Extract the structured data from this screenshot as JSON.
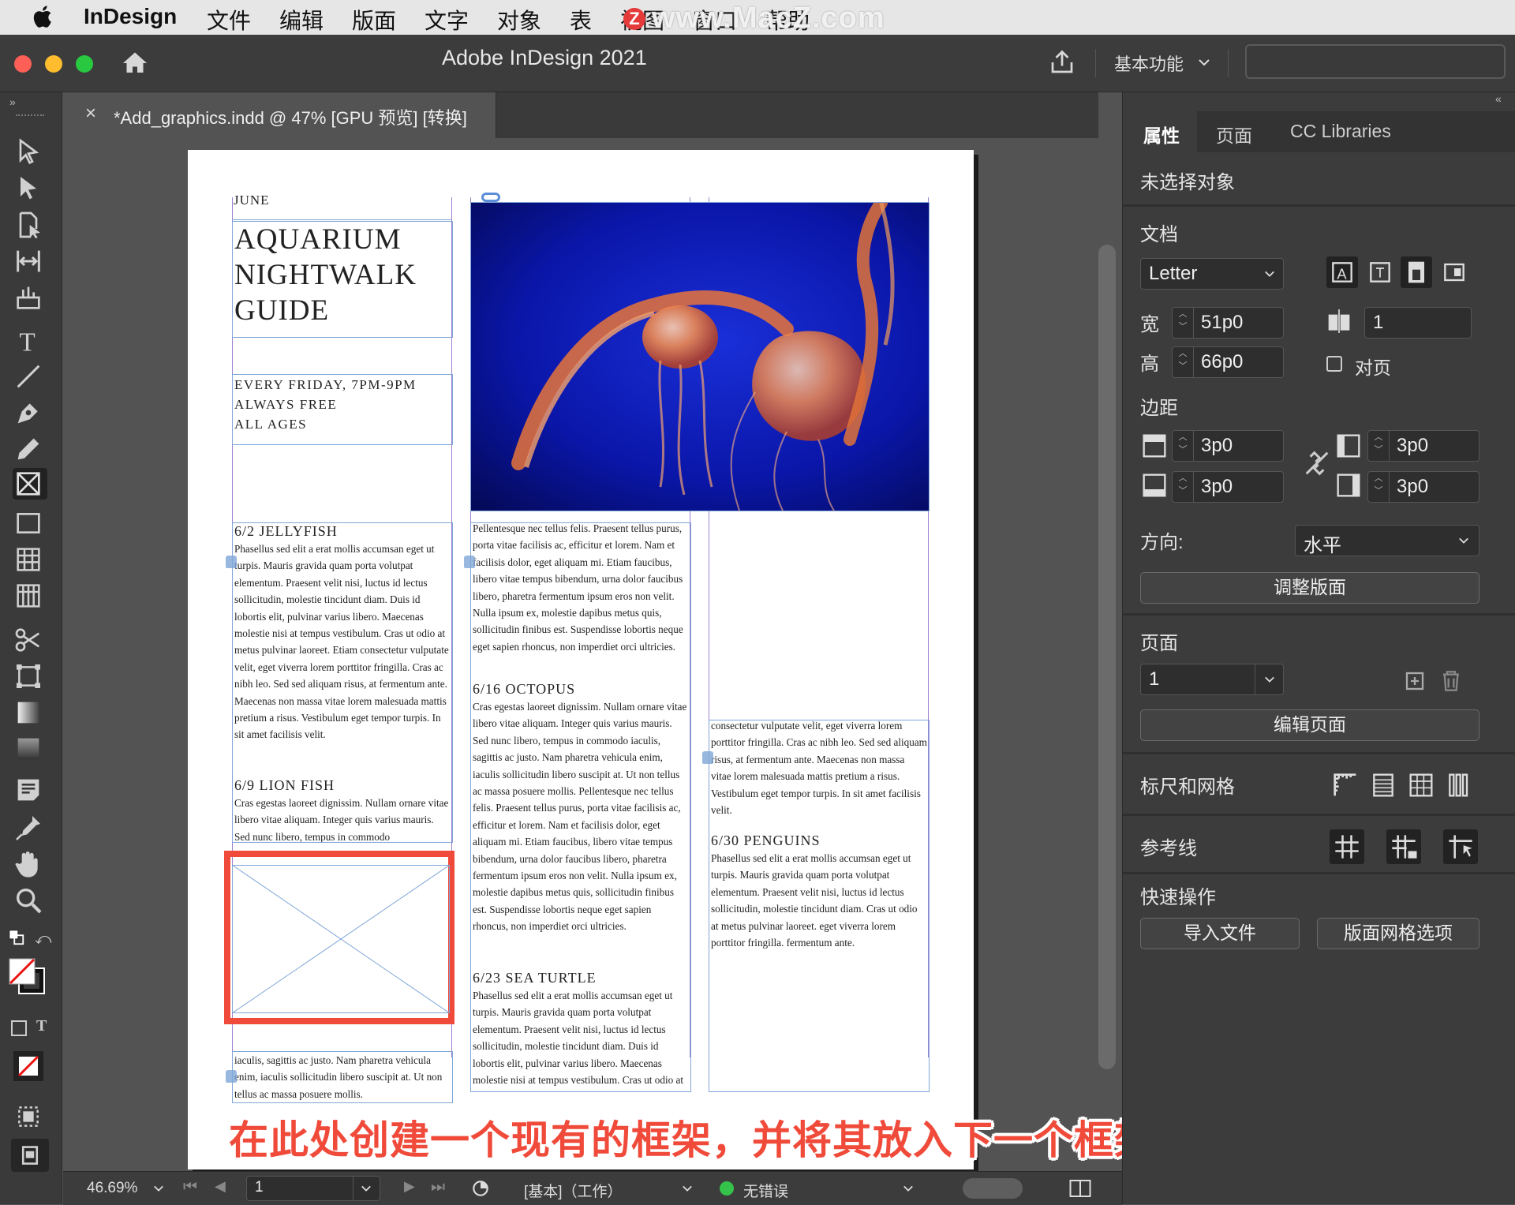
{
  "menubar": {
    "app": "InDesign",
    "items": [
      "文件",
      "编辑",
      "版面",
      "文字",
      "对象",
      "表",
      "视图",
      "窗口",
      "帮助"
    ],
    "watermark": "www.MacZ.com"
  },
  "titlebar": {
    "title": "Adobe InDesign 2021",
    "workspace": "基本功能"
  },
  "document_tab": {
    "close": "×",
    "label": "*Add_graphics.indd @ 47% [GPU 预览] [转换]"
  },
  "page": {
    "month": "JUNE",
    "title_lines": [
      "AQUARIUM",
      "NIGHTWALK",
      "GUIDE"
    ],
    "info_lines": [
      "EVERY FRIDAY, 7PM-9PM",
      "ALWAYS FREE",
      "ALL AGES"
    ],
    "col1_events": [
      {
        "heading": "6/2 JELLYFISH",
        "body": "Phasellus sed elit a erat mollis accumsan eget ut turpis. Mauris gravida quam porta volutpat elementum. Praesent velit nisi, luctus id lectus sollicitudin, molestie tincidunt diam. Duis id lobortis elit, pulvinar varius libero. Maecenas molestie nisi at tempus vestibulum. Cras ut odio at metus pulvinar laoreet. Etiam consectetur vulputate velit, eget viverra lorem porttitor fringilla. Cras ac nibh leo. Sed sed aliquam risus, at fermentum ante. Maecenas non massa vitae lorem malesuada mattis pretium a risus. Vestibulum eget tempor turpis. In sit amet facilisis velit."
      },
      {
        "heading": "6/9 LION FISH",
        "body": "Cras egestas laoreet dignissim. Nullam ornare vitae libero vitae aliquam. Integer quis varius mauris. Sed nunc libero, tempus in commodo"
      }
    ],
    "col1_bottom": "iaculis, sagittis ac justo. Nam pharetra vehicula enim, iaculis sollicitudin libero suscipit at. Ut non tellus ac massa posuere mollis.",
    "col2_top": "Pellentesque nec tellus felis. Praesent tellus purus, porta vitae facilisis ac, efficitur et lorem. Nam et facilisis dolor, eget aliquam mi. Etiam faucibus, libero vitae tempus bibendum, urna dolor faucibus libero, pharetra fermentum ipsum eros non velit. Nulla ipsum ex, molestie dapibus metus quis, sollicitudin finibus est. Suspendisse lobortis neque eget sapien rhoncus, non imperdiet orci ultricies.",
    "col2_events": [
      {
        "heading": "6/16 OCTOPUS",
        "body": "Cras egestas laoreet dignissim. Nullam ornare vitae libero vitae aliquam. Integer quis varius mauris. Sed nunc libero, tempus in commodo iaculis, sagittis ac justo. Nam pharetra vehicula enim, iaculis sollicitudin libero suscipit at. Ut non tellus ac massa posuere mollis. Pellentesque nec tellus felis. Praesent tellus purus, porta vitae facilisis ac, efficitur et lorem. Nam et facilisis dolor, eget aliquam mi. Etiam faucibus, libero vitae tempus bibendum, urna dolor faucibus libero, pharetra fermentum ipsum eros non velit. Nulla ipsum ex, molestie dapibus metus quis, sollicitudin finibus est. Suspendisse lobortis neque eget sapien rhoncus, non imperdiet orci ultricies."
      },
      {
        "heading": "6/23 SEA TURTLE",
        "body": "Phasellus sed elit a erat mollis accumsan eget ut turpis. Mauris gravida quam porta volutpat elementum. Praesent velit nisi, luctus id lectus sollicitudin, molestie tincidunt diam. Duis id lobortis elit, pulvinar varius libero. Maecenas molestie nisi at tempus vestibulum. Cras ut odio at metus pulvinar laoreet. Etiam"
      }
    ],
    "col3_top": "consectetur vulputate velit, eget viverra lorem porttitor fringilla. Cras ac nibh leo. Sed sed aliquam risus, at fermentum ante. Maecenas non massa vitae lorem malesuada mattis pretium a risus. Vestibulum eget tempor turpis. In sit amet facilisis velit.",
    "col3_events": [
      {
        "heading": "6/30 PENGUINS",
        "body": "Phasellus sed elit a erat mollis accumsan eget ut turpis. Mauris gravida quam porta volutpat elementum. Praesent velit nisi, luctus id lectus sollicitudin, molestie tincidunt diam. Cras ut odio at metus pulvinar laoreet. eget viverra lorem porttitor fringilla. fermentum ante."
      }
    ]
  },
  "caption": "在此处创建一个现有的框架，并将其放入下一个框架中",
  "panel": {
    "tabs": [
      "属性",
      "页面",
      "CC Libraries"
    ],
    "no_selection": "未选择对象",
    "document_label": "文档",
    "page_size": "Letter",
    "width_label": "宽",
    "width_value": "51p0",
    "height_label": "高",
    "height_value": "66p0",
    "pages_count": "1",
    "facing_pages": "对页",
    "margins_label": "边距",
    "margin_top": "3p0",
    "margin_bottom": "3p0",
    "margin_left": "3p0",
    "margin_right": "3p0",
    "orientation_label": "方向:",
    "orientation_value": "水平",
    "adjust_layout": "调整版面",
    "page_section": "页面",
    "page_number": "1",
    "edit_page": "编辑页面",
    "rulers_grids": "标尺和网格",
    "guides": "参考线",
    "quick_actions": "快速操作",
    "import_file": "导入文件",
    "layout_grid_options": "版面网格选项"
  },
  "statusbar": {
    "zoom": "46.69%",
    "page": "1",
    "profile": "[基本]（工作）",
    "preflight": "无错误"
  },
  "colors": {
    "accent_red": "#f04a3a",
    "frame_purple": "#9c7fd0",
    "preflight_green": "#34c24a"
  }
}
